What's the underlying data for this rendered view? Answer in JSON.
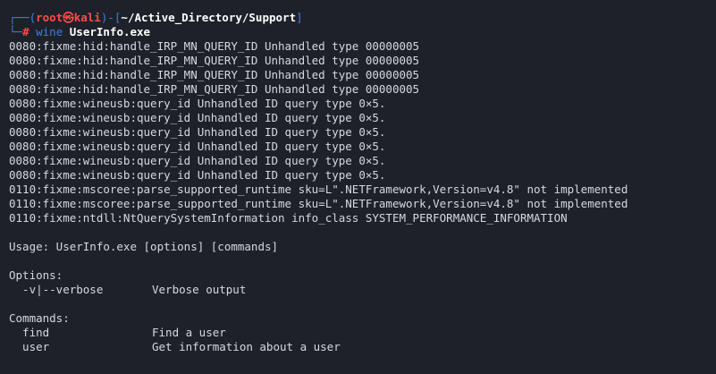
{
  "prompt": {
    "top_prefix": "┌──(",
    "user": "root",
    "at_symbol": "㉿",
    "host": "kali",
    "path_open": ")-[",
    "path": "~/Active_Directory/Support",
    "path_close": "]",
    "bottom_prefix": "└─",
    "hash": "#",
    "command_name": "wine",
    "command_arg": "UserInfo.exe"
  },
  "output_lines": [
    "0080:fixme:hid:handle_IRP_MN_QUERY_ID Unhandled type 00000005",
    "0080:fixme:hid:handle_IRP_MN_QUERY_ID Unhandled type 00000005",
    "0080:fixme:hid:handle_IRP_MN_QUERY_ID Unhandled type 00000005",
    "0080:fixme:hid:handle_IRP_MN_QUERY_ID Unhandled type 00000005",
    "0080:fixme:wineusb:query_id Unhandled ID query type 0×5.",
    "0080:fixme:wineusb:query_id Unhandled ID query type 0×5.",
    "0080:fixme:wineusb:query_id Unhandled ID query type 0×5.",
    "0080:fixme:wineusb:query_id Unhandled ID query type 0×5.",
    "0080:fixme:wineusb:query_id Unhandled ID query type 0×5.",
    "0080:fixme:wineusb:query_id Unhandled ID query type 0×5.",
    "0110:fixme:mscoree:parse_supported_runtime sku=L\".NETFramework,Version=v4.8\" not implemented",
    "0110:fixme:mscoree:parse_supported_runtime sku=L\".NETFramework,Version=v4.8\" not implemented",
    "0110:fixme:ntdll:NtQuerySystemInformation info_class SYSTEM_PERFORMANCE_INFORMATION"
  ],
  "usage": {
    "line": "Usage: UserInfo.exe [options] [commands]",
    "options_header": "Options:",
    "options": [
      {
        "name": "  -v|--verbose",
        "description": "Verbose output"
      }
    ],
    "commands_header": "Commands:",
    "commands": [
      {
        "name": "  find",
        "description": "Find a user"
      },
      {
        "name": "  user",
        "description": "Get information about a user"
      }
    ]
  },
  "colors": {
    "background": "#1e2129",
    "prompt_frame": "#3d7fe0",
    "prompt_user": "#ff4a4a",
    "text": "#d6d9df"
  }
}
